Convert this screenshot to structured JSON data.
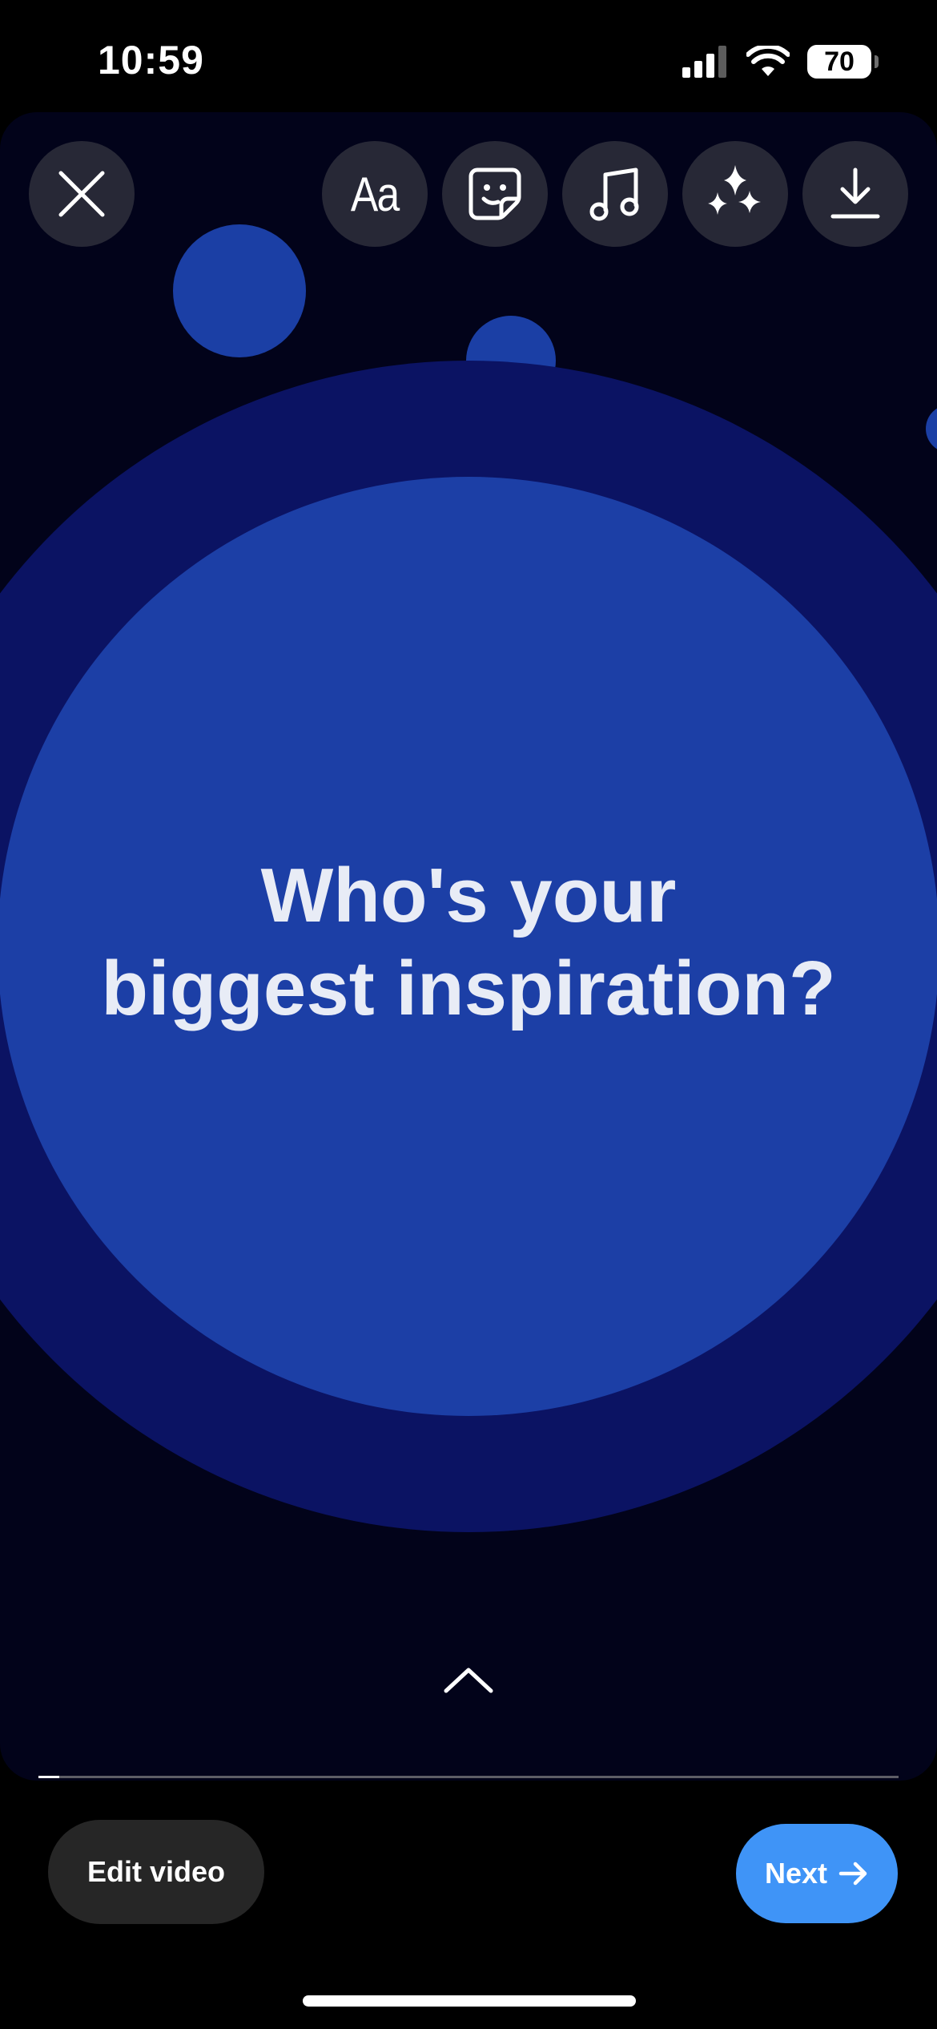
{
  "status_bar": {
    "time": "10:59",
    "battery_level": "70",
    "icons": [
      "cellular-signal-icon",
      "wifi-icon",
      "battery-icon"
    ]
  },
  "toolbar": {
    "close": "close-icon",
    "text_tool_glyph": "Aa",
    "sticker": "sticker-icon",
    "music": "music-note-icon",
    "effects": "sparkles-icon",
    "download": "download-icon"
  },
  "story": {
    "question_line_1": "Who's your",
    "question_line_2": "biggest inspiration?",
    "expand_icon": "chevron-up-icon"
  },
  "actions": {
    "edit_video_label": "Edit video",
    "next_label": "Next",
    "next_icon": "arrow-right-icon"
  },
  "colors": {
    "canvas_background": "#02031a",
    "outer_circle": "#0b1363",
    "inner_circle": "#1c3fa6",
    "bubble": "#1b3fa5",
    "next_button": "#3f94f7",
    "edit_button": "#262626"
  }
}
